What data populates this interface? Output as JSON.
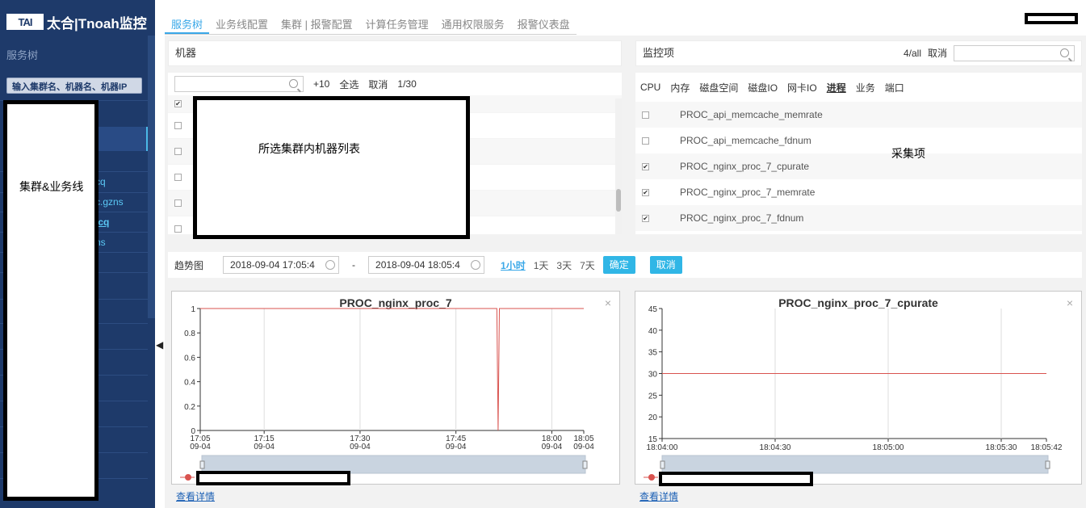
{
  "app": {
    "logo_mark": "TAI",
    "title": "太合|Tnoah监控"
  },
  "sidebar": {
    "title": "服务树",
    "search_placeholder": "输入集群名、机器名、机器IP",
    "partial_items": [
      "cq",
      "c.gzns",
      "icq",
      "ns"
    ],
    "redaction_label": "集群&业务线"
  },
  "tabs": [
    "服务树",
    "业务线配置",
    "集群 | 报警配置",
    "计算任务管理",
    "通用权限服务",
    "报警仪表盘"
  ],
  "machines": {
    "header": "机器",
    "add": "+10",
    "select_all": "全选",
    "cancel": "取消",
    "page": "1/30",
    "redaction_label": "所选集群内机器列表",
    "rows_checked": [
      true,
      false,
      false,
      false,
      false,
      false
    ]
  },
  "monitor": {
    "header": "监控项",
    "count": "4/all",
    "cancel": "取消",
    "tabs": [
      "CPU",
      "内存",
      "磁盘空间",
      "磁盘IO",
      "网卡IO",
      "进程",
      "业务",
      "端口"
    ],
    "active_tab": "进程",
    "items": [
      {
        "name": "PROC_api_memcache_memrate",
        "checked": false
      },
      {
        "name": "PROC_api_memcache_fdnum",
        "checked": false
      },
      {
        "name": "PROC_nginx_proc_7_cpurate",
        "checked": true
      },
      {
        "name": "PROC_nginx_proc_7_memrate",
        "checked": true
      },
      {
        "name": "PROC_nginx_proc_7_fdnum",
        "checked": true
      }
    ],
    "collect_label": "采集项"
  },
  "trend": {
    "label": "趋势图",
    "start": "2018-09-04 17:05:4",
    "sep": "-",
    "end": "2018-09-04 18:05:4",
    "ranges": [
      "1小时",
      "1天",
      "3天",
      "7天"
    ],
    "active_range": "1小时",
    "confirm": "确定",
    "cancel": "取消"
  },
  "detail_link": "查看详情",
  "chart_data": [
    {
      "type": "line",
      "title": "PROC_nginx_proc_7",
      "ylim": [
        0,
        1
      ],
      "yticks": [
        "0",
        "0.2",
        "0.4",
        "0.6",
        "0.8",
        "1"
      ],
      "xticks": [
        [
          "17:05",
          "09-04"
        ],
        [
          "17:15",
          "09-04"
        ],
        [
          "17:30",
          "09-04"
        ],
        [
          "17:45",
          "09-04"
        ],
        [
          "18:00",
          "09-04"
        ],
        [
          "18:05",
          "09-04"
        ]
      ],
      "xtick_minutes": [
        0,
        10,
        25,
        40,
        55,
        60
      ],
      "series": [
        {
          "color": "#d9534f",
          "x": [
            0,
            46.4,
            46.6,
            46.8,
            60
          ],
          "y": [
            1,
            1,
            0,
            1,
            1
          ]
        }
      ],
      "grid": true
    },
    {
      "type": "line",
      "title": "PROC_nginx_proc_7_cpurate",
      "ylim": [
        15,
        45
      ],
      "yticks": [
        "15",
        "20",
        "25",
        "30",
        "35",
        "40",
        "45"
      ],
      "xticks": [
        "18:04:00",
        "18:04:30",
        "18:05:00",
        "18:05:30",
        "18:05:42"
      ],
      "xtick_seconds": [
        0,
        30,
        60,
        90,
        102
      ],
      "series": [
        {
          "color": "#d9534f",
          "x": [
            0,
            102
          ],
          "y": [
            30,
            30
          ]
        }
      ],
      "grid": true
    }
  ]
}
